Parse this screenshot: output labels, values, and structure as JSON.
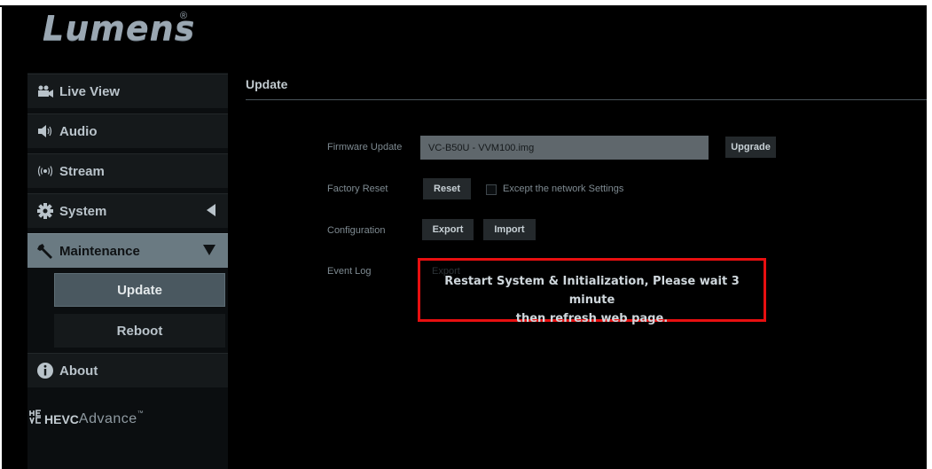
{
  "brand": {
    "logo": "Lumens",
    "registered_mark": "®"
  },
  "sidebar": {
    "items": [
      {
        "label": "Live View",
        "icon": "video-camera-icon"
      },
      {
        "label": "Audio",
        "icon": "speaker-icon"
      },
      {
        "label": "Stream",
        "icon": "broadcast-icon"
      },
      {
        "label": "System",
        "icon": "gear-icon",
        "expanded": false
      },
      {
        "label": "Maintenance",
        "icon": "wrench-icon",
        "expanded": true
      },
      {
        "label": "About",
        "icon": "info-icon"
      }
    ],
    "subitems": [
      {
        "label": "Update",
        "active": true
      },
      {
        "label": "Reboot",
        "active": false
      }
    ],
    "hevc": {
      "badge": "HEVC",
      "suffix": "Advance",
      "tm": "™"
    }
  },
  "main": {
    "title": "Update",
    "firmware": {
      "label": "Firmware Update",
      "value": "VC-B50U - VVM100.img",
      "button": "Upgrade"
    },
    "factory_reset": {
      "label": "Factory Reset",
      "button": "Reset",
      "checkbox_label": "Except the network Settings",
      "checked": false
    },
    "configuration": {
      "label": "Configuration",
      "export": "Export",
      "import": "Import"
    },
    "event_log": {
      "label": "Event Log",
      "export": "Export"
    },
    "notice": {
      "line1": "Restart System & Initialization, Please wait 3 minute",
      "line2": "then refresh web page."
    }
  },
  "colors": {
    "background": "#000000",
    "sidebar_active": "#6a7a82",
    "notice_border": "#e80f10"
  }
}
